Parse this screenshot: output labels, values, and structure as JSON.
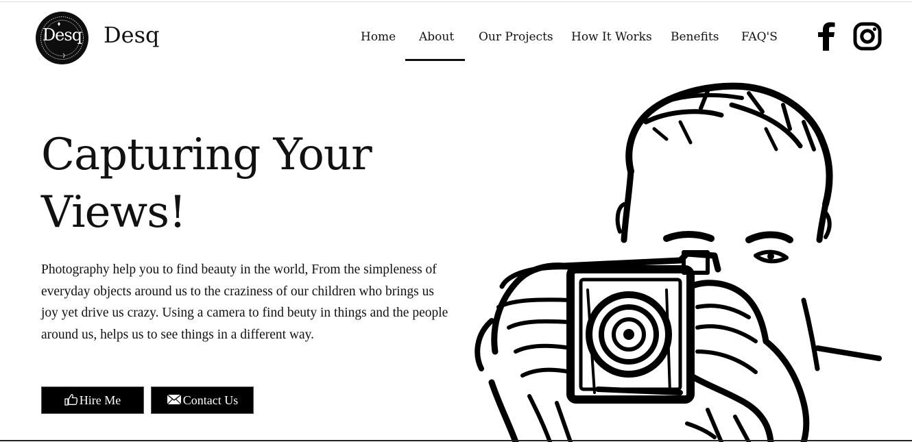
{
  "brand": {
    "badge_text": "Desq",
    "name": "Desq"
  },
  "nav": {
    "items": [
      {
        "label": "Home"
      },
      {
        "label": "About"
      },
      {
        "label": "Our Projects"
      },
      {
        "label": "How It Works"
      },
      {
        "label": "Benefits"
      },
      {
        "label": "FAQ'S"
      }
    ],
    "active": "About"
  },
  "social": {
    "icons": [
      "facebook-icon",
      "instagram-icon"
    ]
  },
  "hero": {
    "title_line1": "Capturing Your",
    "title_line2": "Views!",
    "description": "Photography help you to find beauty in the world, From the simpleness of everyday objects around us to the craziness of our children who brings us joy yet drive us crazy. Using a camera to find beuty in things and the people around us, helps us to see things in a different way.",
    "illustration_icon": "photographer-illustration"
  },
  "buttons": {
    "hire_label": "Hire Me",
    "hire_icon": "thumbs-up-icon",
    "contact_label": "Contact Us",
    "contact_icon": "envelope-icon"
  },
  "colors": {
    "background": "#ffffff",
    "text": "#111111",
    "button_bg": "#000000",
    "button_text": "#ffffff"
  }
}
